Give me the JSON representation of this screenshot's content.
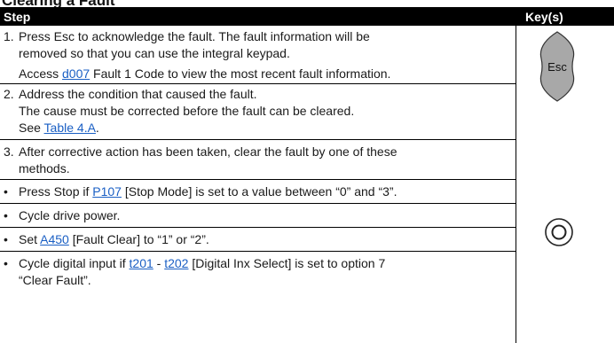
{
  "section_heading": "Clearing a Fault",
  "table": {
    "header_step": "Step",
    "header_keys": "Key(s)"
  },
  "steps": {
    "s1": {
      "num": "1.",
      "line1": "Press Esc to acknowledge the fault. The fault information will be",
      "line2": "removed so that you can use the integral keypad.",
      "line3_prefix": "Access ",
      "line3_link": "d007",
      "line3_suffix": " Fault 1 Code to view the most recent fault information."
    },
    "s2": {
      "num": "2.",
      "line1": "Address the condition that caused the fault.",
      "line2": "The cause must be corrected before the fault can be cleared.",
      "line3_prefix": "See ",
      "line3_link": "Table 4.A",
      "line3_suffix": "."
    },
    "s3": {
      "num": "3.",
      "line1": "After corrective action has been taken, clear the fault by one of these",
      "line2": "methods."
    }
  },
  "bullets": {
    "b1": {
      "symbol": "•",
      "prefix": "Press Stop if ",
      "link": "P107",
      "suffix": " [Stop Mode] is set to a value between “0” and “3”."
    },
    "b2": {
      "symbol": "•",
      "text": "Cycle drive power."
    },
    "b3": {
      "symbol": "•",
      "prefix": "Set ",
      "link": "A450",
      "suffix": " [Fault Clear] to “1” or “2”."
    },
    "b4": {
      "symbol": "•",
      "prefix": "Cycle digital input if ",
      "link1": "t201",
      "mid": " - ",
      "link2": "t202",
      "suffix": " [Digital Inx Select] is set to option 7",
      "line2": "“Clear Fault”."
    }
  },
  "keys": {
    "esc_label": "Esc",
    "esc_icon": "esc-key-icon",
    "stop_icon": "stop-key-icon"
  },
  "colors": {
    "header_bg": "#000000",
    "link": "#1a5fc4",
    "key_fill": "#a8a8a8"
  }
}
